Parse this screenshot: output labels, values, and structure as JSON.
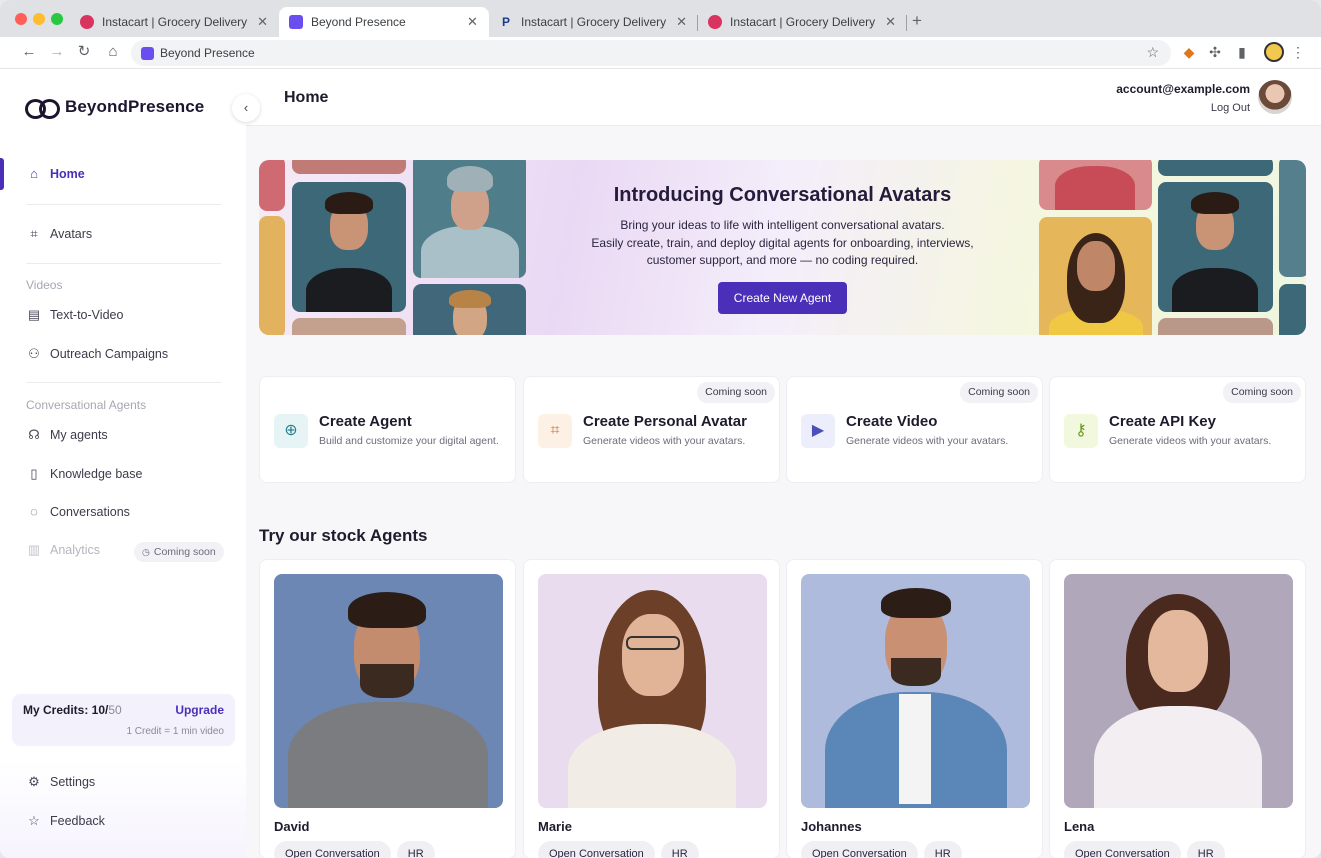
{
  "browser": {
    "tabs": [
      {
        "title": "Instacart | Grocery Delivery or",
        "favicon": "instacart-icon",
        "active": false
      },
      {
        "title": "Beyond Presence",
        "favicon": "beyond-presence-icon",
        "active": true
      },
      {
        "title": "Instacart | Grocery Delivery or",
        "favicon": "paypal-icon",
        "active": false
      },
      {
        "title": "Instacart | Grocery Delivery or",
        "favicon": "instacart-icon",
        "active": false
      }
    ],
    "address_bar": "Beyond Presence"
  },
  "sidebar": {
    "logo_text": "BeyondPresence",
    "items": {
      "home": "Home",
      "avatars": "Avatars",
      "videos_section": "Videos",
      "text_to_video": "Text-to-Video",
      "outreach": "Outreach Campaigns",
      "conv_section": "Conversational Agents",
      "my_agents": "My agents",
      "knowledge_base": "Knowledge base",
      "conversations": "Conversations",
      "analytics": "Analytics",
      "analytics_badge": "Coming soon",
      "settings": "Settings",
      "feedback": "Feedback"
    },
    "credits": {
      "label": "My Credits: 10/",
      "max": "50",
      "upgrade": "Upgrade",
      "note": "1 Credit = 1 min video"
    }
  },
  "header": {
    "title": "Home",
    "email": "account@example.com",
    "logout": "Log Out"
  },
  "hero": {
    "title": "Introducing Conversational Avatars",
    "subtitle_lines": [
      "Bring your ideas to life with intelligent conversational avatars.",
      "Easily create, train, and deploy digital agents for onboarding, interviews,",
      "customer support, and more — no coding required."
    ],
    "button": "Create New Agent"
  },
  "cards": [
    {
      "title": "Create Agent",
      "desc": "Build and customize your digital agent.",
      "badge": "",
      "icon": "agent-plus-icon"
    },
    {
      "title": "Create Personal Avatar",
      "desc": "Generate videos with your avatars.",
      "badge": "Coming soon",
      "icon": "avatar-frame-icon"
    },
    {
      "title": "Create Video",
      "desc": "Generate videos with your avatars.",
      "badge": "Coming soon",
      "icon": "play-icon"
    },
    {
      "title": "Create API Key",
      "desc": "Generate videos with your avatars.",
      "badge": "Coming soon",
      "icon": "key-icon"
    }
  ],
  "stock_section_title": "Try our stock Agents",
  "agents": [
    {
      "name": "David",
      "action": "Open Conversation",
      "tag": "HR"
    },
    {
      "name": "Marie",
      "action": "Open Conversation",
      "tag": "HR"
    },
    {
      "name": "Johannes",
      "action": "Open Conversation",
      "tag": "HR"
    },
    {
      "name": "Lena",
      "action": "Open Conversation",
      "tag": "HR"
    }
  ],
  "colors": {
    "accent": "#4b2fb8",
    "sidebar_active": "#4b2fb8"
  }
}
